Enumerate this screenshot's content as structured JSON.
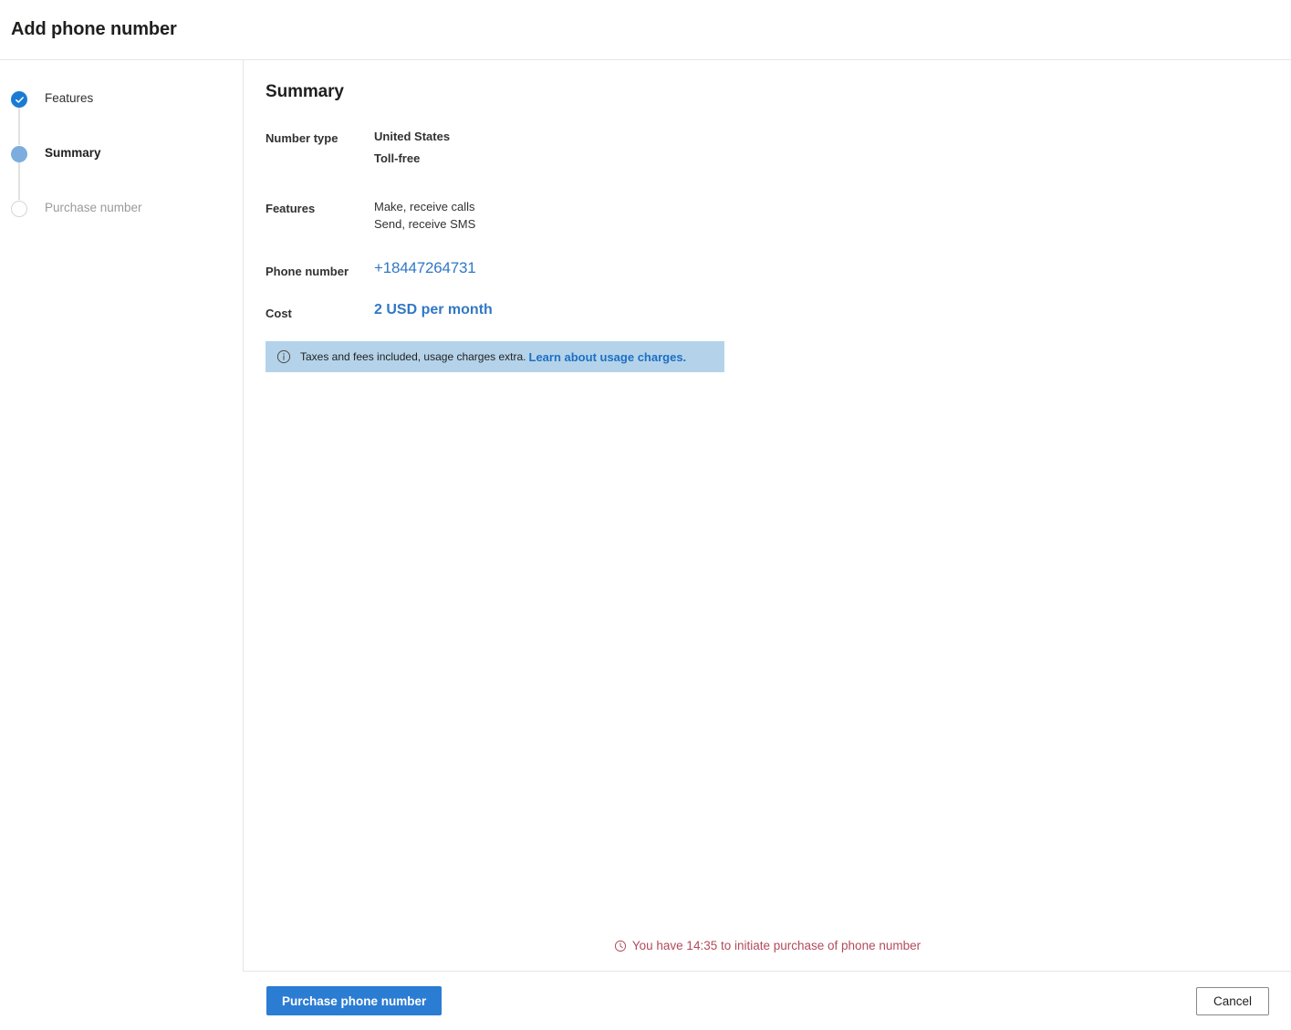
{
  "header": {
    "title": "Add phone number"
  },
  "sidebar": {
    "steps": [
      {
        "label": "Features",
        "state": "done",
        "icon": "check-icon"
      },
      {
        "label": "Summary",
        "state": "current",
        "icon": "filled-circle-icon"
      },
      {
        "label": "Purchase number",
        "state": "pending",
        "icon": "empty-circle-icon"
      }
    ]
  },
  "main": {
    "title": "Summary",
    "rows": {
      "number_type": {
        "label": "Number type",
        "values": [
          "United States",
          "Toll-free"
        ]
      },
      "features": {
        "label": "Features",
        "values": [
          "Make, receive calls",
          "Send, receive SMS"
        ]
      },
      "phone_number": {
        "label": "Phone number",
        "value": "+18447264731"
      },
      "cost": {
        "label": "Cost",
        "value": "2 USD per month"
      }
    },
    "banner": {
      "icon": "info-icon",
      "text": "Taxes and fees included, usage charges extra.",
      "link_label": "Learn about usage charges.",
      "background_color": "#b4d3ea",
      "link_color": "#1d6fc4"
    },
    "timer": {
      "icon": "clock-icon",
      "text": "You have 14:35 to initiate purchase of phone number",
      "color": "#b24a5b"
    }
  },
  "footer": {
    "primary_label": "Purchase phone number",
    "secondary_label": "Cancel",
    "primary_color": "#2b7cd3"
  }
}
